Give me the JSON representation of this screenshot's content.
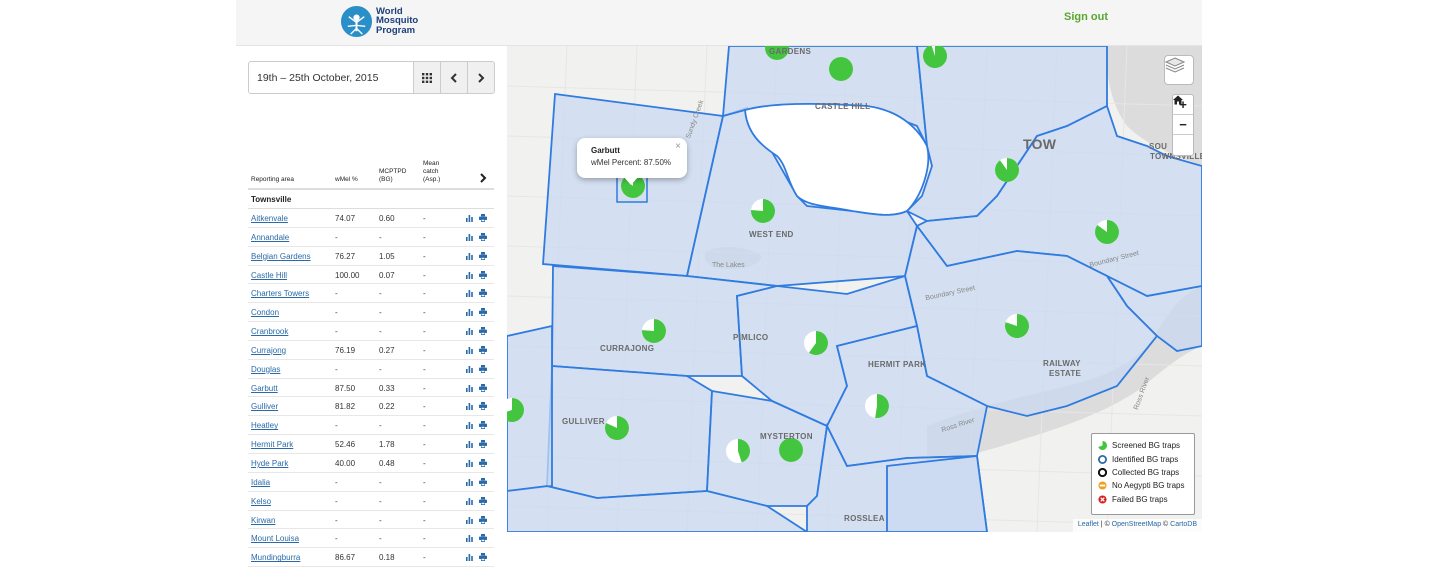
{
  "header": {
    "logo_lines": [
      "World",
      "Mosquito",
      "Program"
    ],
    "sign_out": "Sign out"
  },
  "date_picker": {
    "value": "19th – 25th October, 2015",
    "calendar_icon": "calendar-grid-icon",
    "prev_icon": "chevron-left-icon",
    "next_icon": "chevron-right-icon"
  },
  "table": {
    "columns": {
      "area": "Reporting area",
      "wmel": "wMel %",
      "mcptpd": [
        "MCPTPD",
        "(BG)"
      ],
      "mean": [
        "Mean",
        "catch",
        "(Asp.)"
      ]
    },
    "group": "Townsville",
    "rows": [
      {
        "area": "Aitkenvale",
        "wmel": "74.07",
        "mcptpd": "0.60",
        "mean": "-"
      },
      {
        "area": "Annandale",
        "wmel": "-",
        "mcptpd": "-",
        "mean": "-"
      },
      {
        "area": "Belgian Gardens",
        "wmel": "76.27",
        "mcptpd": "1.05",
        "mean": "-"
      },
      {
        "area": "Castle Hill",
        "wmel": "100.00",
        "mcptpd": "0.07",
        "mean": "-"
      },
      {
        "area": "Charters Towers",
        "wmel": "-",
        "mcptpd": "-",
        "mean": "-"
      },
      {
        "area": "Condon",
        "wmel": "-",
        "mcptpd": "-",
        "mean": "-"
      },
      {
        "area": "Cranbrook",
        "wmel": "-",
        "mcptpd": "-",
        "mean": "-"
      },
      {
        "area": "Currajong",
        "wmel": "76.19",
        "mcptpd": "0.27",
        "mean": "-"
      },
      {
        "area": "Douglas",
        "wmel": "-",
        "mcptpd": "-",
        "mean": "-"
      },
      {
        "area": "Garbutt",
        "wmel": "87.50",
        "mcptpd": "0.33",
        "mean": "-"
      },
      {
        "area": "Gulliver",
        "wmel": "81.82",
        "mcptpd": "0.22",
        "mean": "-"
      },
      {
        "area": "Heatley",
        "wmel": "-",
        "mcptpd": "-",
        "mean": "-"
      },
      {
        "area": "Hermit Park",
        "wmel": "52.46",
        "mcptpd": "1.78",
        "mean": "-"
      },
      {
        "area": "Hyde Park",
        "wmel": "40.00",
        "mcptpd": "0.48",
        "mean": "-"
      },
      {
        "area": "Idalia",
        "wmel": "-",
        "mcptpd": "-",
        "mean": "-"
      },
      {
        "area": "Kelso",
        "wmel": "-",
        "mcptpd": "-",
        "mean": "-"
      },
      {
        "area": "Kirwan",
        "wmel": "-",
        "mcptpd": "-",
        "mean": "-"
      },
      {
        "area": "Mount Louisa",
        "wmel": "-",
        "mcptpd": "-",
        "mean": "-"
      },
      {
        "area": "Mundingburra",
        "wmel": "86.67",
        "mcptpd": "0.18",
        "mean": "-"
      }
    ],
    "row_icons": [
      "bar-chart-icon",
      "print-icon"
    ]
  },
  "map": {
    "popup": {
      "title": "Garbutt",
      "body": "wMel Percent: 87.50%"
    },
    "zoom_in": "+",
    "zoom_out": "−",
    "suburb_labels": {
      "castle_hill": "CASTLE HILL",
      "gardens": "GARDENS",
      "west_end": "WEST END",
      "currajong": "CURRAJONG",
      "pimlico": "PIMLICO",
      "hermit_park": "HERMIT PARK",
      "railway_estate_1": "RAILWAY",
      "railway_estate_2": "ESTATE",
      "gulliver": "GULLIVER",
      "mysterton": "MYSTERTON",
      "rosslea": "ROSSLEA",
      "town": "TOW",
      "south_town_1": "SOU",
      "south_town_2": "TOWNSVILLE"
    },
    "street_labels": {
      "the_lakes": "The Lakes",
      "boundary_street_1": "Boundary Street",
      "boundary_street_2": "Boundary Street",
      "ross_river": "Ross River",
      "ross_river_2": "Ross River",
      "sundy_creek": "Sundy Creek"
    },
    "legend": [
      {
        "label": "Screened BG traps",
        "icon": "screened-pie-icon",
        "color": "#3cc13c"
      },
      {
        "label": "Identified BG traps",
        "icon": "identified-circle-icon",
        "color": "#2a6aa8"
      },
      {
        "label": "Collected BG traps",
        "icon": "collected-circle-icon",
        "color": "#111111"
      },
      {
        "label": "No Aegypti BG traps",
        "icon": "no-aegypti-icon",
        "color": "#f0a020"
      },
      {
        "label": "Failed BG traps",
        "icon": "failed-icon",
        "color": "#d02020"
      }
    ],
    "attribution": {
      "leaflet": "Leaflet",
      "osm": "OpenStreetMap",
      "carto": "CartoDB",
      "sep": " | © ",
      "sep2": " © "
    },
    "pies": [
      {
        "name": "garbutt",
        "pct": 87.5
      },
      {
        "name": "gardens-top",
        "pct": 100
      },
      {
        "name": "castle-hill-1",
        "pct": 100
      },
      {
        "name": "castle-hill-2",
        "pct": 95
      },
      {
        "name": "west-end",
        "pct": 76.27
      },
      {
        "name": "town",
        "pct": 90
      },
      {
        "name": "south-town",
        "pct": 85
      },
      {
        "name": "currajong",
        "pct": 76.19
      },
      {
        "name": "pimlico",
        "pct": 60
      },
      {
        "name": "railway-estate",
        "pct": 80
      },
      {
        "name": "hermit-park",
        "pct": 52.46
      },
      {
        "name": "gulliver",
        "pct": 81.82
      },
      {
        "name": "left-edge",
        "pct": 70
      },
      {
        "name": "mysterton-1",
        "pct": 45
      },
      {
        "name": "mysterton-2",
        "pct": 100
      }
    ],
    "colors": {
      "zone_fill": "#c9d9f2",
      "zone_stroke": "#2f7be0",
      "pie_green": "#44c540",
      "pie_empty": "#ffffff",
      "water": "#dcdcdc"
    }
  }
}
